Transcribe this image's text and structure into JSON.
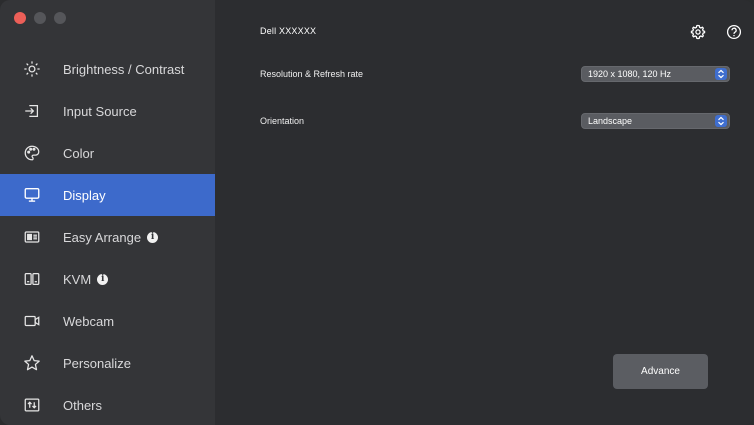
{
  "window": {
    "traffic_lights": [
      "close",
      "minimize",
      "zoom"
    ],
    "colors": {
      "close": "#ec5f58",
      "inactive": "#55565a"
    }
  },
  "header": {
    "monitor_name": "Dell XXXXXX",
    "icons": [
      "gear-icon",
      "help-icon"
    ]
  },
  "sidebar": {
    "items": [
      {
        "label": "Brightness / Contrast",
        "icon": "brightness-icon",
        "active": false,
        "info": false
      },
      {
        "label": "Input Source",
        "icon": "input-source-icon",
        "active": false,
        "info": false
      },
      {
        "label": "Color",
        "icon": "color-palette-icon",
        "active": false,
        "info": false
      },
      {
        "label": "Display",
        "icon": "monitor-icon",
        "active": true,
        "info": false
      },
      {
        "label": "Easy Arrange",
        "icon": "easy-arrange-icon",
        "active": false,
        "info": true
      },
      {
        "label": "KVM",
        "icon": "kvm-icon",
        "active": false,
        "info": true
      },
      {
        "label": "Webcam",
        "icon": "webcam-icon",
        "active": false,
        "info": false
      },
      {
        "label": "Personalize",
        "icon": "star-icon",
        "active": false,
        "info": false
      },
      {
        "label": "Others",
        "icon": "others-icon",
        "active": false,
        "info": false
      }
    ],
    "active_color": "#3d6acb"
  },
  "settings": {
    "resolution": {
      "label": "Resolution & Refresh rate",
      "value": "1920 x 1080, 120 Hz"
    },
    "orientation": {
      "label": "Orientation",
      "value": "Landscape"
    }
  },
  "advance_button": {
    "label": "Advance"
  },
  "colors": {
    "accent": "#3f6ecf",
    "background": "#2c2d30",
    "sidebar": "#343538"
  }
}
